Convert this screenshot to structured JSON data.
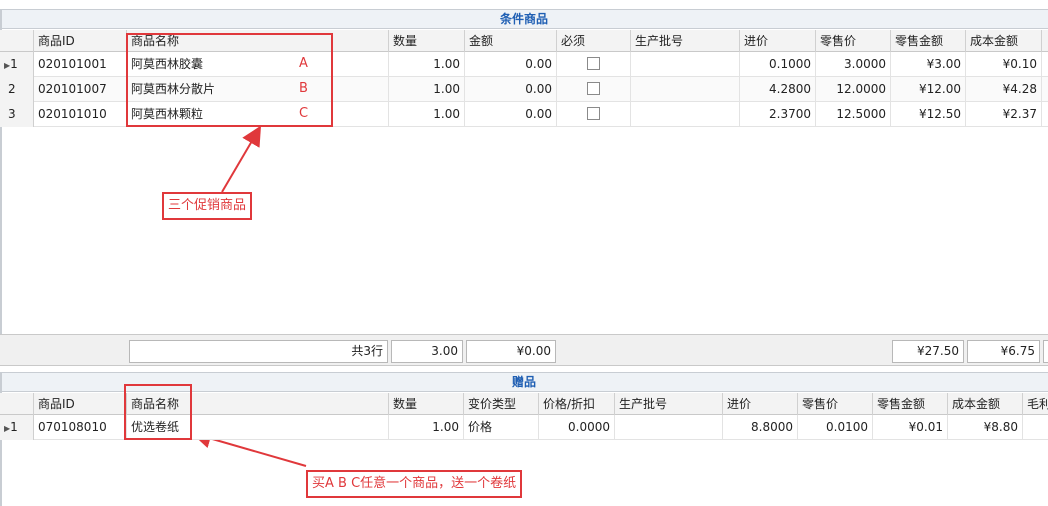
{
  "top": {
    "title": "条件商品",
    "headers": [
      "商品ID",
      "商品名称",
      "数量",
      "金额",
      "必须",
      "生产批号",
      "进价",
      "零售价",
      "零售金额",
      "成本金额"
    ],
    "rows": [
      {
        "num": "1",
        "id": "020101001",
        "name": "阿莫西林胶囊",
        "letter": "A",
        "qty": "1.00",
        "amount": "0.00",
        "batch": "",
        "cost_price": "0.1000",
        "retail_price": "3.0000",
        "retail_amt": "¥3.00",
        "cost_amt": "¥0.10"
      },
      {
        "num": "2",
        "id": "020101007",
        "name": "阿莫西林分散片",
        "letter": "B",
        "qty": "1.00",
        "amount": "0.00",
        "batch": "",
        "cost_price": "4.2800",
        "retail_price": "12.0000",
        "retail_amt": "¥12.00",
        "cost_amt": "¥4.28"
      },
      {
        "num": "3",
        "id": "020101010",
        "name": "阿莫西林颗粒",
        "letter": "C",
        "qty": "1.00",
        "amount": "0.00",
        "batch": "",
        "cost_price": "2.3700",
        "retail_price": "12.5000",
        "retail_amt": "¥12.50",
        "cost_amt": "¥2.37"
      }
    ],
    "footer": {
      "rows_count": "共3行",
      "qty_total": "3.00",
      "amount_total": "¥0.00",
      "retail_total": "¥27.50",
      "cost_total": "¥6.75"
    },
    "annotation": "三个促销商品"
  },
  "bottom": {
    "title": "赠品",
    "headers": [
      "商品ID",
      "商品名称",
      "数量",
      "变价类型",
      "价格/折扣",
      "生产批号",
      "进价",
      "零售价",
      "零售金额",
      "成本金额",
      "毛利"
    ],
    "rows": [
      {
        "num": "1",
        "id": "070108010",
        "name": "优选卷纸",
        "qty": "1.00",
        "price_type": "价格",
        "price": "0.0000",
        "batch": "",
        "cost_price": "8.8000",
        "retail_price": "0.0100",
        "retail_amt": "¥0.01",
        "cost_amt": "¥8.80"
      }
    ],
    "annotation": "买A B C任意一个商品，送一个卷纸"
  },
  "colors": {
    "title": "#1f5fb3",
    "annotation": "#e0383b"
  }
}
